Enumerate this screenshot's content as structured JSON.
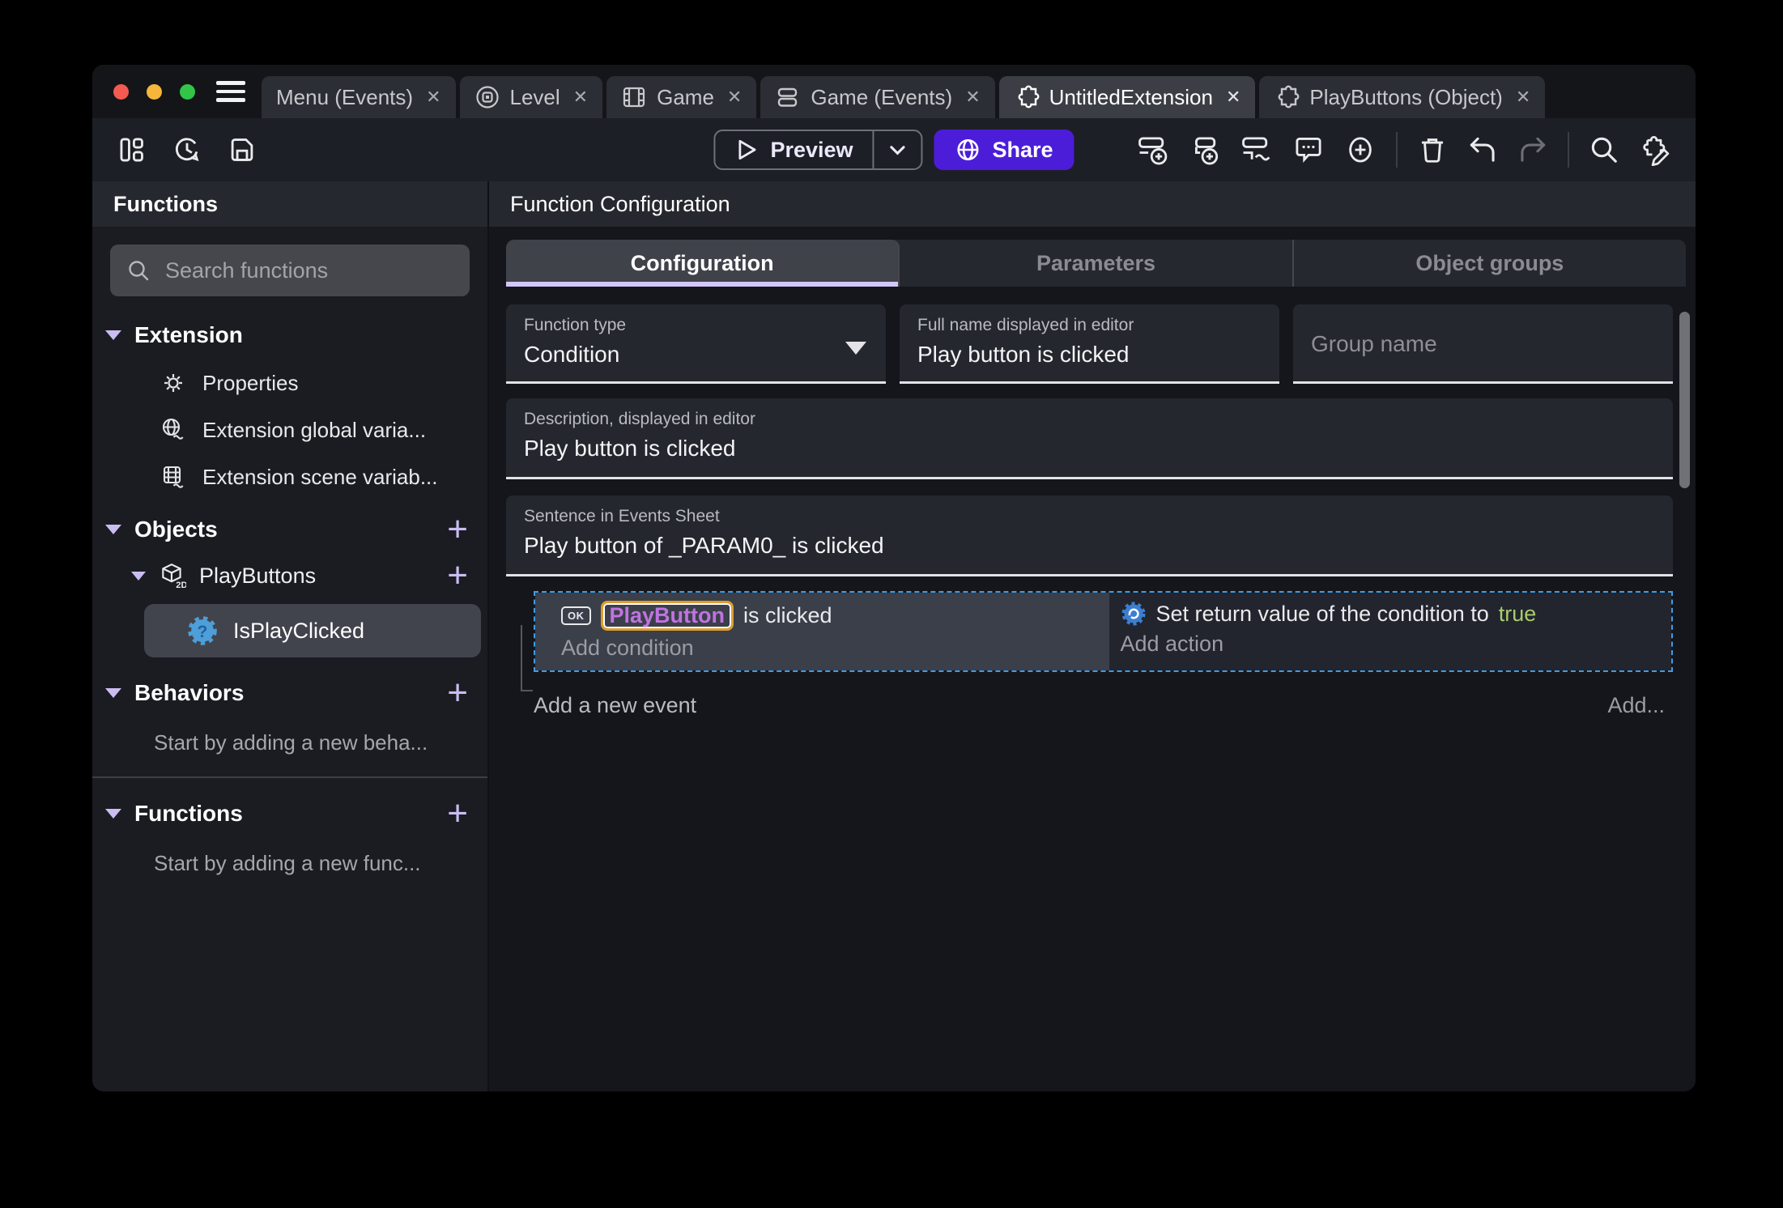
{
  "icons": {
    "close": "✕",
    "plus": "+",
    "ok_badge": "OK"
  },
  "titlebar": {
    "tabs": [
      {
        "label": "Menu (Events)"
      },
      {
        "label": "Level"
      },
      {
        "label": "Game"
      },
      {
        "label": "Game (Events)"
      },
      {
        "label": "UntitledExtension"
      },
      {
        "label": "PlayButtons (Object)"
      }
    ]
  },
  "toolbar": {
    "preview_label": "Preview",
    "share_label": "Share"
  },
  "sidebar": {
    "title": "Functions",
    "search_placeholder": "Search functions",
    "extension": {
      "label": "Extension",
      "items": [
        {
          "label": "Properties"
        },
        {
          "label": "Extension global varia..."
        },
        {
          "label": "Extension scene variab..."
        }
      ]
    },
    "objects": {
      "label": "Objects",
      "group_label": "PlayButtons",
      "selected": "IsPlayClicked"
    },
    "behaviors": {
      "label": "Behaviors",
      "empty": "Start by adding a new beha..."
    },
    "functions": {
      "label": "Functions",
      "empty": "Start by adding a new func..."
    }
  },
  "main": {
    "panel_title": "Function Configuration",
    "tabs": [
      {
        "label": "Configuration"
      },
      {
        "label": "Parameters"
      },
      {
        "label": "Object groups"
      }
    ],
    "fields": {
      "function_type": {
        "label": "Function type",
        "value": "Condition"
      },
      "full_name": {
        "label": "Full name displayed in editor",
        "value": "Play button is clicked"
      },
      "group_name": {
        "placeholder": "Group name"
      },
      "description": {
        "label": "Description, displayed in editor",
        "value": "Play button is clicked"
      },
      "sentence": {
        "label": "Sentence in Events Sheet",
        "value": "Play button of _PARAM0_ is clicked"
      }
    },
    "events": {
      "condition_object": "PlayButton",
      "condition_text": "is clicked",
      "add_condition": "Add condition",
      "action_text": "Set return value of the condition to",
      "action_value": "true",
      "add_action": "Add action",
      "add_event": "Add a new event",
      "add_button": "Add..."
    }
  },
  "colors": {
    "share_button": "#4c1dd9",
    "tab_underline": "#d4c6fa",
    "object_name": "#c173e0",
    "object_highlight_border": "#dd9e2f",
    "true_value": "#a8cc6c",
    "event_selection": "#3e9ce6"
  }
}
